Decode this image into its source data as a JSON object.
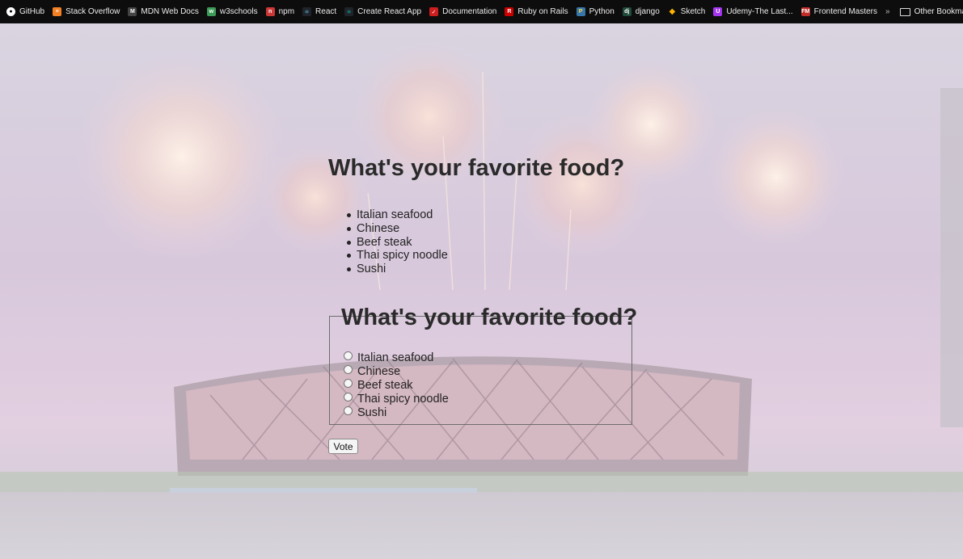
{
  "bookmarks": [
    {
      "label": "GitHub",
      "icon": "github-icon",
      "color": "#ffffff"
    },
    {
      "label": "Stack Overflow",
      "icon": "stackoverflow-icon",
      "color": "#f48024"
    },
    {
      "label": "MDN Web Docs",
      "icon": "mdn-icon",
      "color": "#b0b0b0"
    },
    {
      "label": "w3schools",
      "icon": "w3schools-icon",
      "color": "#3c9b58"
    },
    {
      "label": "npm",
      "icon": "npm-icon",
      "color": "#cb3837"
    },
    {
      "label": "React",
      "icon": "react-icon",
      "color": "#61dafb"
    },
    {
      "label": "Create React App",
      "icon": "create-react-app-icon",
      "color": "#09d3ac"
    },
    {
      "label": "Documentation",
      "icon": "documentation-icon",
      "color": "#cc1e1e"
    },
    {
      "label": "Ruby on Rails",
      "icon": "rails-icon",
      "color": "#cc0000"
    },
    {
      "label": "Python",
      "icon": "python-icon",
      "color": "#3776ab"
    },
    {
      "label": "django",
      "icon": "django-icon",
      "color": "#1f4a39"
    },
    {
      "label": "Sketch",
      "icon": "sketch-icon",
      "color": "#fdb300"
    },
    {
      "label": "Udemy-The Last...",
      "icon": "udemy-icon",
      "color": "#a435f0"
    },
    {
      "label": "Frontend Masters",
      "icon": "frontend-masters-icon",
      "color": "#c02d28"
    }
  ],
  "overflow_label": "»",
  "other_bookmarks_label": "Other Bookmarks",
  "page": {
    "heading": "What's your favorite food?",
    "foods": [
      "Italian seafood",
      "Chinese",
      "Beef steak",
      "Thai spicy noodle",
      "Sushi"
    ],
    "form_legend": "What's your favorite food?",
    "options": [
      "Italian seafood",
      "Chinese",
      "Beef steak",
      "Thai spicy noodle",
      "Sushi"
    ],
    "vote_label": "Vote"
  }
}
